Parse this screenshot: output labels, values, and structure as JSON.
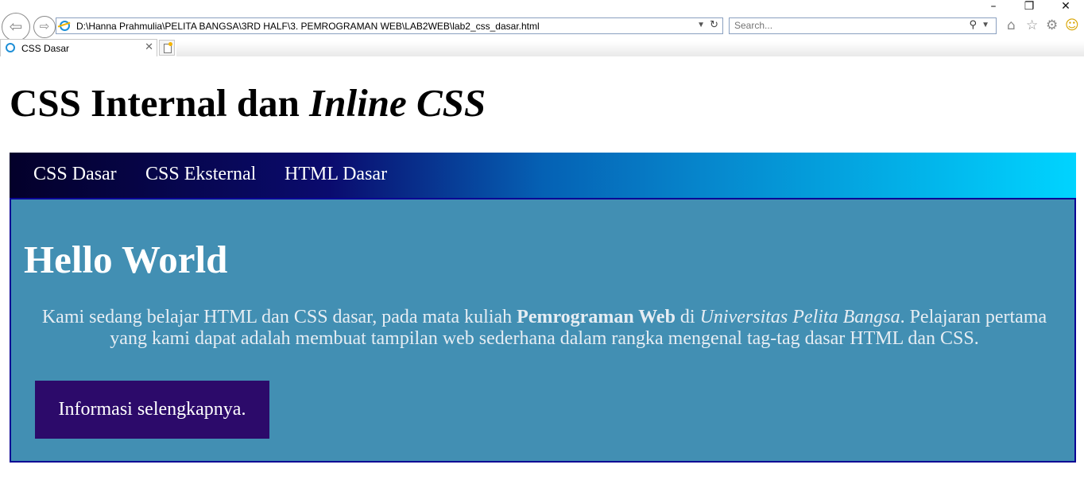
{
  "browser": {
    "address_url": "D:\\Hanna Prahmulia\\PELITA BANGSA\\3RD HALF\\3. PEMROGRAMAN WEB\\LAB2WEB\\lab2_css_dasar.html",
    "search_placeholder": "Search...",
    "tab_title": "CSS Dasar",
    "window_buttons": {
      "minimize": "–",
      "restore": "❐",
      "close": "✕"
    }
  },
  "page": {
    "title_regular": "CSS Internal dan ",
    "title_italic": "Inline CSS",
    "nav": [
      {
        "label": "CSS Dasar"
      },
      {
        "label": "CSS Eksternal"
      },
      {
        "label": "HTML Dasar"
      }
    ],
    "hero": {
      "heading": "Hello World",
      "text_1": "Kami sedang belajar HTML dan CSS dasar, pada mata kuliah ",
      "text_bold": "Pemrograman Web",
      "text_2": " di ",
      "text_italic": "Universitas Pelita Bangsa",
      "text_3": ". Pelajaran pertama yang kami dapat adalah membuat tampilan web sederhana dalam rangka mengenal tag-tag dasar HTML dan CSS.",
      "button_label": "Informasi selengkapnya."
    }
  },
  "colors": {
    "nav_gradient_start": "#03002a",
    "nav_gradient_end": "#00d4ff",
    "main_background": "#428fb3",
    "main_border": "#0b0094",
    "button_background": "#2c0a6a"
  },
  "icons": [
    "back-icon",
    "forward-icon",
    "ie-logo-icon",
    "refresh-icon",
    "search-icon",
    "home-icon",
    "favorites-star-icon",
    "settings-gear-icon",
    "smiley-feedback-icon",
    "close-icon",
    "new-tab-icon"
  ]
}
